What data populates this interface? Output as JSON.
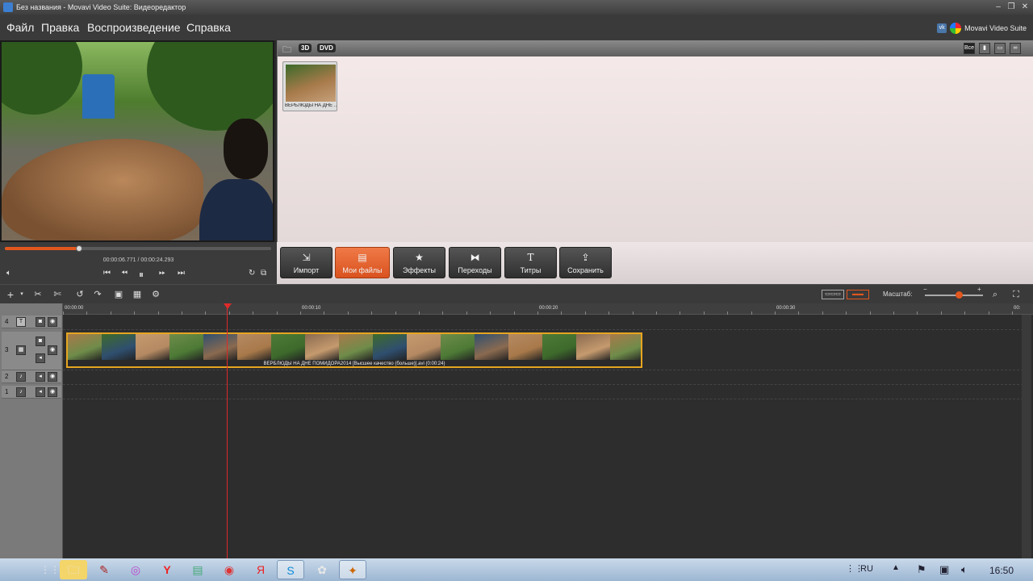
{
  "window": {
    "title": "Без названия - Movavi Video Suite: Видеоредактор",
    "minimize_glyph": "–",
    "restore_glyph": "❐",
    "close_glyph": "✕"
  },
  "menu": [
    "Файл",
    "Правка",
    "Воспроизведение",
    "Справка"
  ],
  "brand": {
    "badge": "vk",
    "text": "Movavi Video Suite"
  },
  "library": {
    "tags": [
      "3D",
      "DVD"
    ],
    "filter_all": "Все",
    "view_icons": [
      "film-icon",
      "window-icon",
      "link-icon"
    ],
    "items": [
      {
        "label": "ВЕРБЛЮДЫ НА ДНЕ ..."
      }
    ]
  },
  "player": {
    "current_time": "00:00:06.771",
    "separator": "/",
    "total_time": "00:00:24.293",
    "progress": 0.28
  },
  "tools": [
    {
      "label": "Импорт",
      "icon": "import-icon",
      "glyph": "⇲",
      "active": false
    },
    {
      "label": "Мои файлы",
      "icon": "my-files-icon",
      "glyph": "▤",
      "active": true
    },
    {
      "label": "Эффекты",
      "icon": "star-icon",
      "glyph": "★",
      "active": false
    },
    {
      "label": "Переходы",
      "icon": "transitions-icon",
      "glyph": "⧓",
      "active": false
    },
    {
      "label": "Титры",
      "icon": "titles-icon",
      "glyph": "T",
      "active": false
    },
    {
      "label": "Сохранить",
      "icon": "save-icon",
      "glyph": "⇪",
      "active": false
    }
  ],
  "timeline": {
    "zoom_label": "Масштаб:",
    "zoom_level": 0.58,
    "ruler": [
      "00:00:00",
      "00:00:10",
      "00:00:20",
      "00:00:30",
      "00:"
    ],
    "tracks": [
      "4",
      "3",
      "2",
      "1"
    ],
    "clip_label": "ВЕРБЛЮДЫ НА ДНЕ ПОМИДОРА2014 [Высшее качество (больше)].avi (0:00:24)"
  },
  "taskbar": {
    "language": "RU",
    "clock": "16:50"
  },
  "colors": {
    "accent": "#e2571e",
    "clip_border": "#e6a520",
    "playhead": "#e02a2a"
  }
}
